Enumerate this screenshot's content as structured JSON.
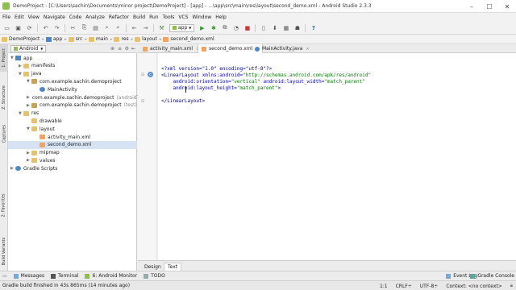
{
  "titlebar": {
    "title": "DemoProject - [C:\\Users\\sachin\\Documents\\minor project\\DemoProject] - [app] - ...\\app\\src\\main\\res\\layout\\second_demo.xml - Android Studio 2.3.3",
    "minimize": "–",
    "maximize": "☐",
    "close": "✕"
  },
  "menu": [
    "File",
    "Edit",
    "View",
    "Navigate",
    "Code",
    "Analyze",
    "Refactor",
    "Build",
    "Run",
    "Tools",
    "VCS",
    "Window",
    "Help"
  ],
  "toolbar": {
    "app_config": "app",
    "help": "?"
  },
  "breadcrumb": [
    "DemoProject",
    "app",
    "src",
    "main",
    "res",
    "layout",
    "second_demo.xml"
  ],
  "project_panel": {
    "view_selector": "Android",
    "tree": [
      {
        "label": "app",
        "depth": 0,
        "icon": "module",
        "twisty": "▼"
      },
      {
        "label": "manifests",
        "depth": 1,
        "icon": "folder",
        "twisty": "▶"
      },
      {
        "label": "java",
        "depth": 1,
        "icon": "folder",
        "twisty": "▼"
      },
      {
        "label": "com.example.sachin.demoproject",
        "depth": 2,
        "icon": "package",
        "twisty": "▼"
      },
      {
        "label": "MainActivity",
        "depth": 3,
        "icon": "class",
        "twisty": ""
      },
      {
        "label": "com.example.sachin.demoproject",
        "suffix": "(androidTest)",
        "depth": 2,
        "icon": "package",
        "twisty": "▶"
      },
      {
        "label": "com.example.sachin.demoproject",
        "suffix": "(test)",
        "depth": 2,
        "icon": "package",
        "twisty": "▶"
      },
      {
        "label": "res",
        "depth": 1,
        "icon": "folder",
        "twisty": "▼"
      },
      {
        "label": "drawable",
        "depth": 2,
        "icon": "folder",
        "twisty": ""
      },
      {
        "label": "layout",
        "depth": 2,
        "icon": "folder",
        "twisty": "▼"
      },
      {
        "label": "activity_main.xml",
        "depth": 3,
        "icon": "xml",
        "twisty": ""
      },
      {
        "label": "second_demo.xml",
        "depth": 3,
        "icon": "xml",
        "twisty": "",
        "selected": true
      },
      {
        "label": "mipmap",
        "depth": 2,
        "icon": "folder",
        "twisty": "▶"
      },
      {
        "label": "values",
        "depth": 2,
        "icon": "folder",
        "twisty": "▶"
      },
      {
        "label": "Gradle Scripts",
        "depth": 0,
        "icon": "gradle",
        "twisty": "▶"
      }
    ]
  },
  "side_tabs": {
    "project": "1: Project",
    "structure": "Z: Structure",
    "captures": "Captures",
    "favorites": "2: Favorites",
    "build_variants": "Build Variants"
  },
  "editor_tabs": [
    {
      "label": "activity_main.xml",
      "close": "×"
    },
    {
      "label": "second_demo.xml",
      "close": "×",
      "active": true
    },
    {
      "label": "MainActivity.java",
      "close": "×"
    }
  ],
  "code": {
    "line1": "<?xml version=\"1.0\" encoding=\"utf-8\"?>",
    "line2_tag": "<LinearLayout ",
    "line2_attr": "xmlns:android=",
    "line2_val": "\"http://schemas.android.com/apk/res/android\"",
    "line3_attr1": "    android:orientation=",
    "line3_val1": "\"vertical\" ",
    "line3_attr2": "android:layout_width=",
    "line3_val2": "\"match_parent\"",
    "line4_attr": "    android:layout_height=",
    "line4_val": "\"match_parent\"",
    "line4_end": ">",
    "line6": "</LinearLayout>"
  },
  "design_tabs": [
    "Design",
    "Text"
  ],
  "tool_windows": [
    "Messages",
    "Terminal",
    "6: Android Monitor",
    "TODO"
  ],
  "tool_windows_right": [
    "Event Log",
    "Gradle Console"
  ],
  "statusbar": {
    "message": "Gradle build finished in 43s 865ms (14 minutes ago)",
    "position": "1:1",
    "line_sep": "CRLF÷",
    "encoding": "UTF-8÷",
    "context": "Context: <no context>"
  }
}
